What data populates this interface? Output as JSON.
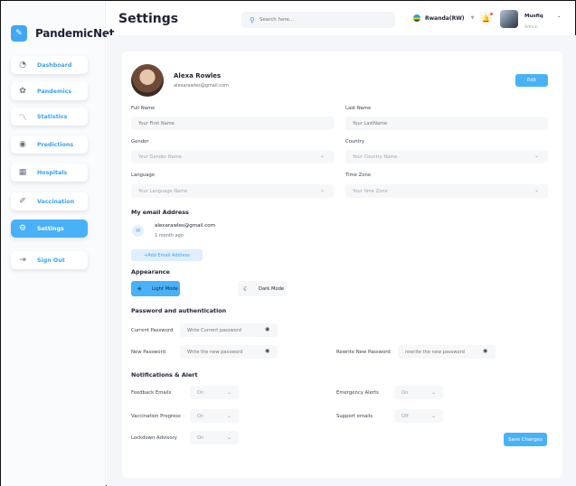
{
  "brand": {
    "name": "PandemicNet"
  },
  "nav": [
    {
      "label": "Dashboard",
      "icon": "dashboard-icon"
    },
    {
      "label": "Pandemics",
      "icon": "virus-icon"
    },
    {
      "label": "Statistics",
      "icon": "chart-line-icon"
    },
    {
      "label": "Predictions",
      "icon": "broadcast-icon"
    },
    {
      "label": "Hospitals",
      "icon": "hospital-icon"
    },
    {
      "label": "Vaccination",
      "icon": "syringe-icon"
    },
    {
      "label": "Settings",
      "icon": "gear-icon",
      "active": true
    },
    {
      "label": "Sign Out",
      "icon": "sign-out-icon"
    }
  ],
  "header": {
    "title": "Settings",
    "search_placeholder": "Search here...",
    "region": "Rwanda(RW)",
    "user_name": "Musfiq",
    "user_role": "Admin"
  },
  "profile": {
    "name": "Alexa Rowles",
    "email": "alexarawles@gmail.com",
    "edit_label": "Edit"
  },
  "form": {
    "full_name_label": "Full Name",
    "full_name_placeholder": "Your First Name",
    "last_name_label": "Last Name",
    "last_name_placeholder": "Your LastName",
    "gender_label": "Gender",
    "gender_placeholder": "Your Gender Name",
    "country_label": "Country",
    "country_placeholder": "Your Country Name",
    "language_label": "Language",
    "language_placeholder": "Your Language Name",
    "timezone_label": "Time Zone",
    "timezone_placeholder": "Your time  Zone"
  },
  "email_section": {
    "title": "My email Address",
    "address": "alexarawles@gmail.com",
    "age": "1 month ago",
    "add_label": "+Add Email Address"
  },
  "appearance": {
    "title": "Appearance",
    "light_label": "Light Mode",
    "dark_label": "Dark Mode"
  },
  "password": {
    "title": "Password and authentication",
    "current_label": "Current Password",
    "current_placeholder": "Write Current password",
    "new_label": "New Password",
    "new_placeholder": "Write the new password",
    "rewrite_label": "Rewrite New Password",
    "rewrite_placeholder": "rewrite the new password"
  },
  "notifications": {
    "title": "Notifications & Alert",
    "feedback_label": "Feedback Emails",
    "feedback_value": "On",
    "emergency_label": "Emergency Alerts",
    "emergency_value": "On",
    "vaccination_label": "Vaccination Progress",
    "vaccination_value": "On",
    "support_label": "Support emails",
    "support_value": "Off",
    "lockdown_label": "Lockdown Advisory",
    "lockdown_value": "On",
    "save_label": "Save Changes"
  },
  "colors": {
    "accent": "#49b1f7",
    "text": "#1e2235"
  }
}
